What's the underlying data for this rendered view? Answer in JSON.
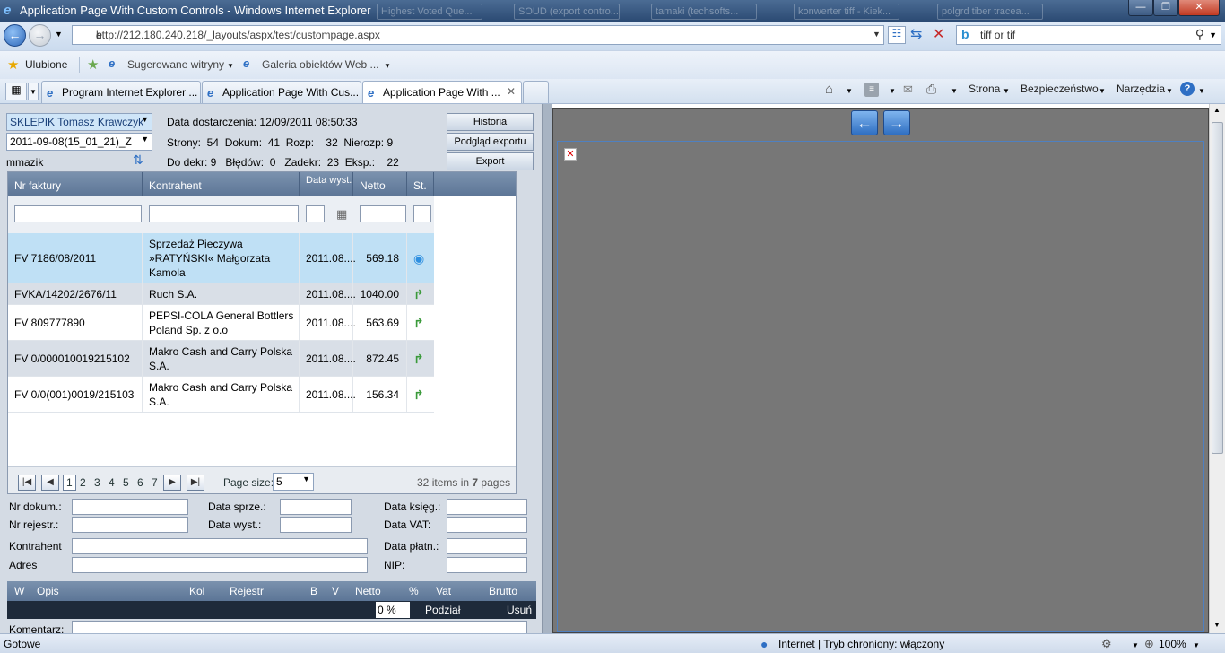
{
  "window": {
    "title": "Application Page With Custom Controls - Windows Internet Explorer",
    "ghost_tabs": [
      "Highest Voted Que...",
      "SOUD (export contro...",
      "tamaki (techsofts...",
      "konwerter tiff - Kiek...",
      "polgrd tiber tracea..."
    ]
  },
  "address": {
    "url": "http://212.180.240.218/_layouts/aspx/test/custompage.aspx"
  },
  "search": {
    "value": "tiff or tif"
  },
  "favorites": {
    "label": "Ulubione",
    "items": [
      "Sugerowane witryny",
      "Galeria obiektów Web ..."
    ]
  },
  "tabs": [
    {
      "label": "Program Internet Explorer ..."
    },
    {
      "label": "Application Page With Cus..."
    },
    {
      "label": "Application Page With ..."
    }
  ],
  "commands": [
    "Strona",
    "Bezpieczeństwo",
    "Narzędzia"
  ],
  "header": {
    "supplier": "SKLEPIK Tomasz Krawczyk",
    "batch": "2011-09-08(15_01_21)_Z",
    "user": "mmazik",
    "delivery": "Data dostarczenia: 12/09/2011 08:50:33",
    "stats1": "Strony:  54  Dokum:  41  Rozp:    32  Nierozp: 9",
    "stats2": "Do dekr: 9   Błędów:  0   Zadekr:  23  Eksp.:    22",
    "btn_history": "Historia",
    "btn_preview": "Podgląd exportu",
    "btn_export": "Export"
  },
  "grid": {
    "columns": [
      "Nr faktury",
      "Kontrahent",
      "Data wyst.",
      "Netto",
      "St."
    ],
    "rows": [
      {
        "nr": "FV 7186/08/2011",
        "kontrahent": "Sprzedaż Pieczywa »RATYŃSKI« Małgorzata Kamola",
        "data": "2011.08....",
        "netto": "569.18"
      },
      {
        "nr": "FVKA/14202/2676/11",
        "kontrahent": "Ruch S.A.",
        "data": "2011.08....",
        "netto": "1040.00"
      },
      {
        "nr": "FV 809777890",
        "kontrahent": "PEPSI-COLA General Bottlers Poland Sp. z o.o",
        "data": "2011.08....",
        "netto": "563.69"
      },
      {
        "nr": "FV 0/000010019215102",
        "kontrahent": "Makro Cash and Carry Polska S.A.",
        "data": "2011.08....",
        "netto": "872.45"
      },
      {
        "nr": "FV 0/0(001)0019/215103",
        "kontrahent": "Makro Cash and Carry Polska S.A.",
        "data": "2011.08....",
        "netto": "156.34"
      }
    ],
    "pager": {
      "pages": [
        "1",
        "2",
        "3",
        "4",
        "5",
        "6",
        "7"
      ],
      "page_size_label": "Page size:",
      "page_size": "5",
      "items_count": "32",
      "items_text": "items in",
      "pages_count": "7",
      "pages_text": "pages"
    }
  },
  "form": {
    "nr_dokum": "Nr dokum.:",
    "nr_rejestr": "Nr rejestr.:",
    "data_sprze": "Data sprze.:",
    "data_wyst": "Data wyst.:",
    "data_ksieg": "Data księg.:",
    "data_vat": "Data VAT:",
    "kontrahent": "Kontrahent",
    "adres": "Adres",
    "data_platn": "Data płatn.:",
    "nip": "NIP:",
    "komentarz": "Komentarz:"
  },
  "lines": {
    "columns": [
      "W",
      "Opis",
      "Kol",
      "Rejestr",
      "B",
      "V",
      "Netto",
      "%",
      "Vat",
      "Brutto"
    ],
    "percent": "0 %",
    "podzial": "Podział",
    "usun": "Usuń"
  },
  "status": {
    "left": "Gotowe",
    "zone": "Internet | Tryb chroniony: włączony",
    "zoom": "100%"
  }
}
